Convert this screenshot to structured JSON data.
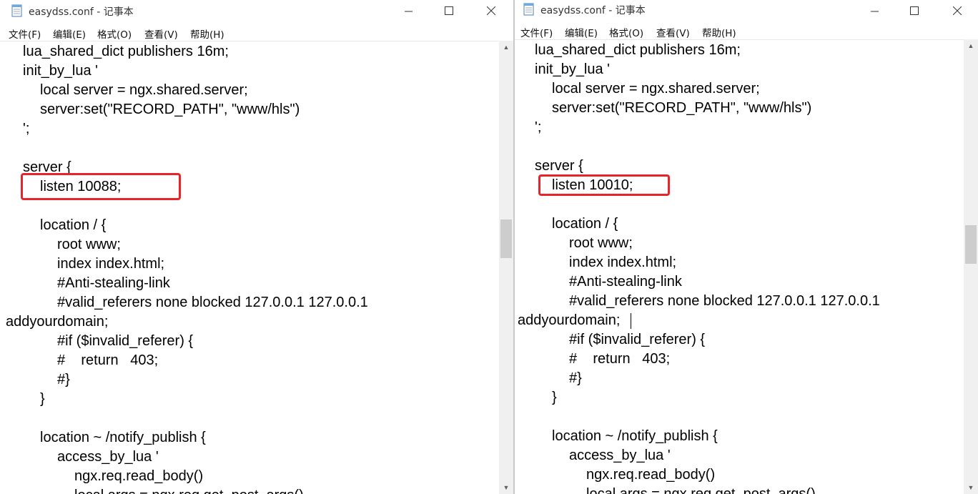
{
  "left": {
    "title": "easydss.conf - 记事本",
    "menu": [
      "文件(F)",
      "编辑(E)",
      "格式(O)",
      "查看(V)",
      "帮助(H)"
    ],
    "lines": [
      "lua_shared_dict publishers 16m;",
      "init_by_lua '",
      "local server = ngx.shared.server;",
      "server:set(\"RECORD_PATH\", \"www/hls\")",
      "';",
      "",
      "server {",
      "listen 10088;",
      "",
      "location / {",
      "root www;",
      "index index.html;",
      "#Anti-stealing-link",
      "#valid_referers none blocked 127.0.0.1 127.0.0.1",
      "addyourdomain;",
      "#if ($invalid_referer) {",
      "#    return   403;",
      "#}",
      "}",
      "",
      "location ~ /notify_publish {",
      "access_by_lua '",
      "ngx.req.read_body()",
      "local args = ngx.req.get_post_args()"
    ]
  },
  "right": {
    "title": "easydss.conf - 记事本",
    "menu": [
      "文件(F)",
      "编辑(E)",
      "格式(O)",
      "查看(V)",
      "帮助(H)"
    ],
    "lines": [
      "lua_shared_dict publishers 16m;",
      "init_by_lua '",
      "local server = ngx.shared.server;",
      "server:set(\"RECORD_PATH\", \"www/hls\")",
      "';",
      "",
      "server {",
      "listen 10010;",
      "",
      "location / {",
      "root www;",
      "index index.html;",
      "#Anti-stealing-link",
      "#valid_referers none blocked 127.0.0.1 127.0.0.1",
      "addyourdomain;",
      "#if ($invalid_referer) {",
      "#    return   403;",
      "#}",
      "}",
      "",
      "location ~ /notify_publish {",
      "access_by_lua '",
      "ngx.req.read_body()",
      "local args = ngx.req.get_post_args()"
    ]
  }
}
